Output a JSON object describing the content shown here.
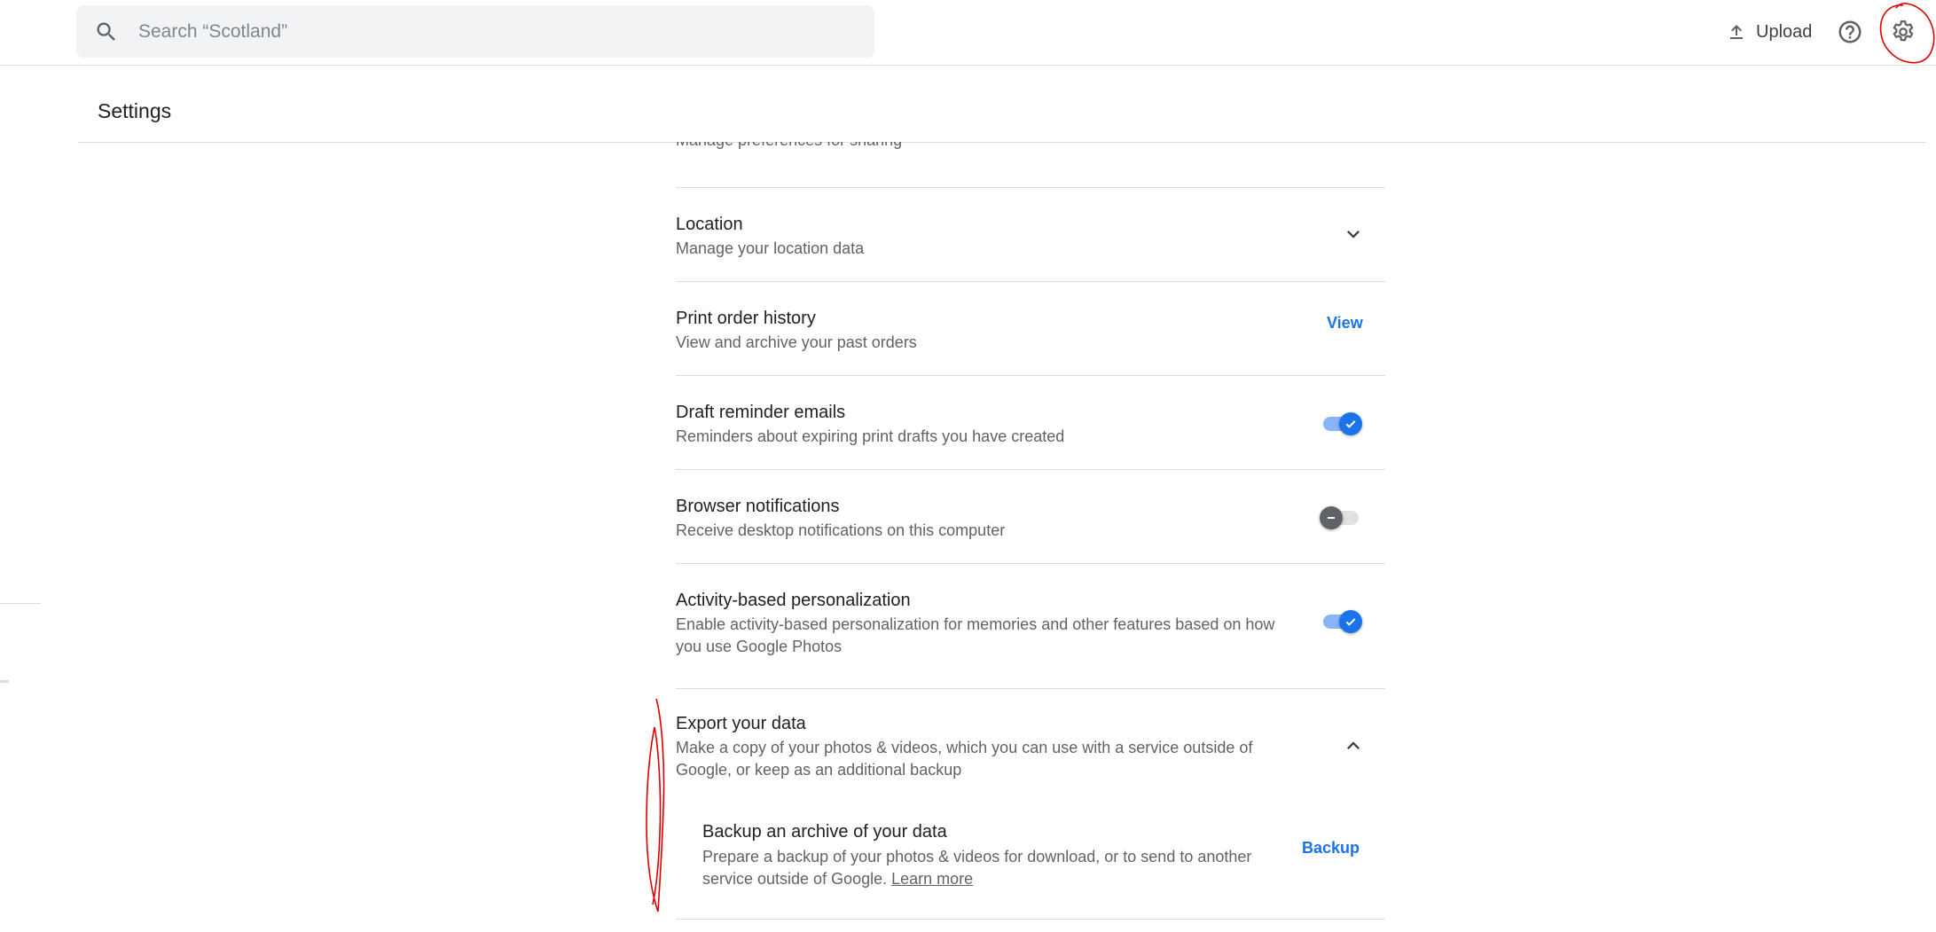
{
  "search": {
    "placeholder": "Search “Scotland”",
    "value": ""
  },
  "toolbar": {
    "upload_label": "Upload",
    "help_icon": "help-circle-icon",
    "settings_icon": "gear-icon"
  },
  "page": {
    "title": "Settings"
  },
  "settings": {
    "sharing_subtitle": "Manage preferences for sharing",
    "location": {
      "title": "Location",
      "subtitle": "Manage your location data"
    },
    "print_order_history": {
      "title": "Print order history",
      "subtitle": "View and archive your past orders",
      "action_label": "View"
    },
    "draft_reminder_emails": {
      "title": "Draft reminder emails",
      "subtitle": "Reminders about expiring print drafts you have created",
      "enabled": true
    },
    "browser_notifications": {
      "title": "Browser notifications",
      "subtitle": "Receive desktop notifications on this computer",
      "enabled": false
    },
    "activity_personalization": {
      "title": "Activity-based personalization",
      "subtitle_line1": "Enable activity-based personalization for memories and other features based on how",
      "subtitle_line2": "you use Google Photos",
      "enabled": true
    },
    "export_data": {
      "title": "Export your data",
      "subtitle_line1": "Make a copy of your photos & videos, which you can use with a service outside of",
      "subtitle_line2": "Google, or keep as an additional backup",
      "expanded": true
    },
    "backup_archive": {
      "title": "Backup an archive of your data",
      "subtitle_line1": "Prepare a backup of your photos & videos for download, or to send to another",
      "subtitle_line2": "service outside of Google.",
      "learn_more": "Learn more",
      "action_label": "Backup"
    }
  },
  "colors": {
    "accent": "#1a73e8",
    "annotation": "#e00000"
  }
}
